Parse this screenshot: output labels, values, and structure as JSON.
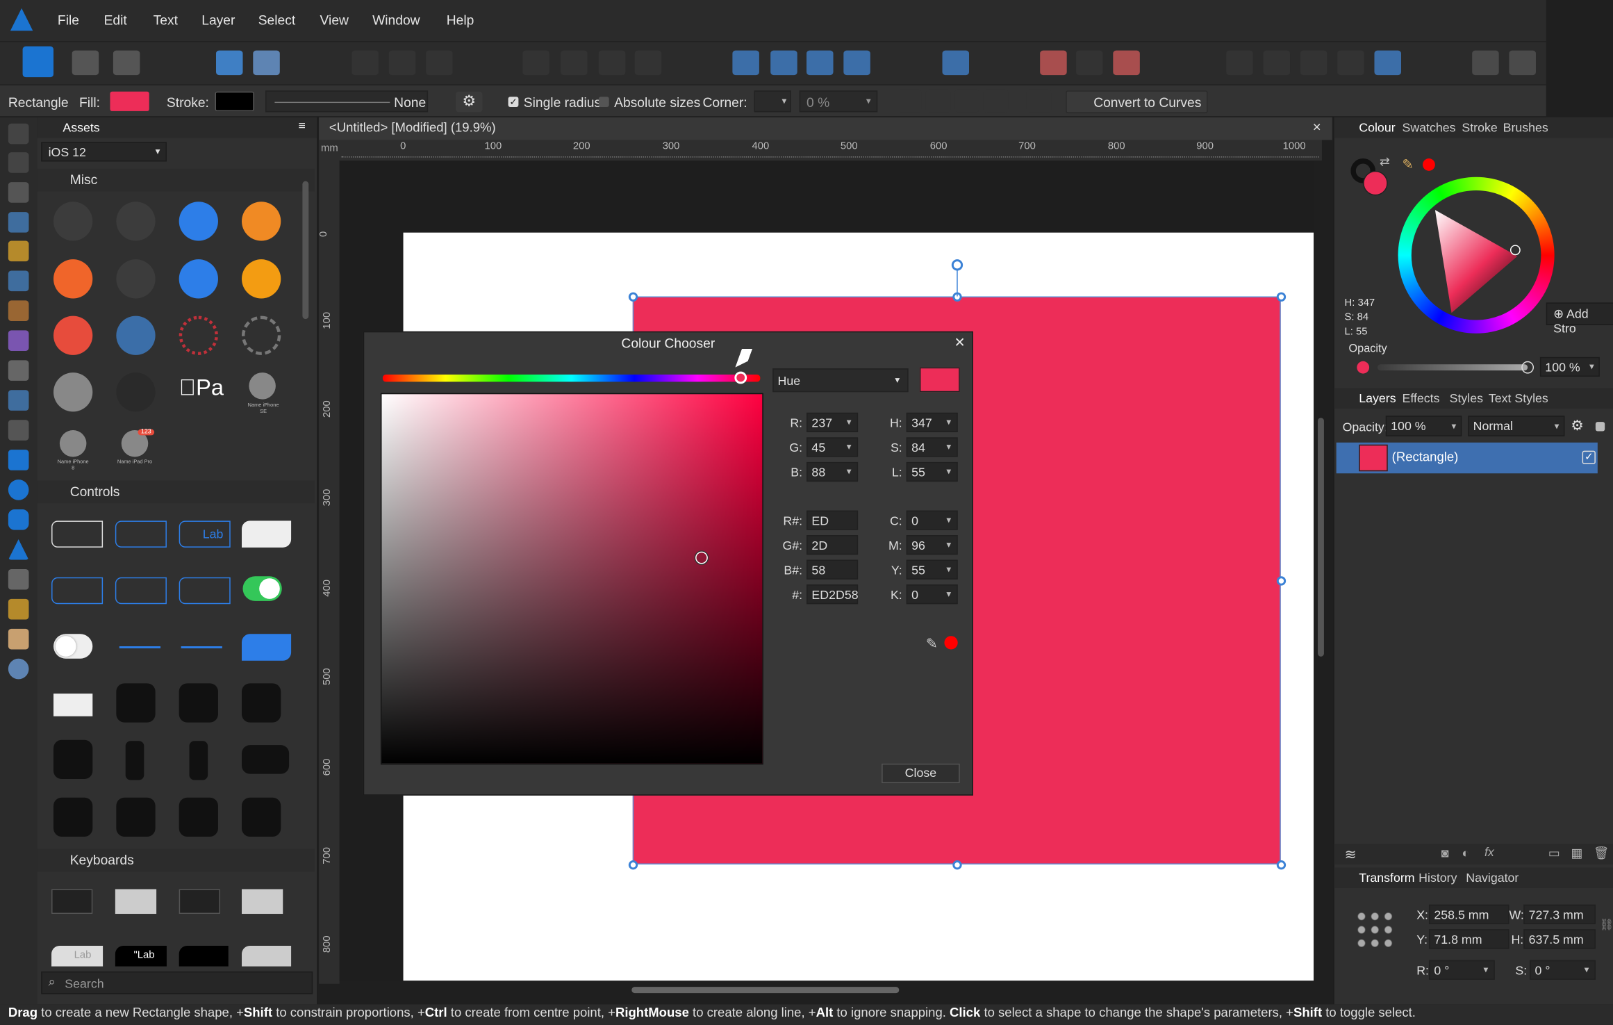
{
  "menu": [
    "File",
    "Edit",
    "Text",
    "Layer",
    "Select",
    "View",
    "Window",
    "Help"
  ],
  "context": {
    "tool_name": "Rectangle",
    "fill_label": "Fill:",
    "stroke_label": "Stroke:",
    "stroke_none": "None",
    "single_radius": "Single radius",
    "absolute_sizes": "Absolute sizes",
    "corner_label": "Corner:",
    "corner_pct": "0 %",
    "convert": "Convert to Curves"
  },
  "assets": {
    "tab": "Assets",
    "set": "iOS 12",
    "sections": [
      "Misc",
      "Controls",
      "Keyboards"
    ],
    "search_placeholder": "Search",
    "misc_labels": [
      "Name iPhone SE",
      "Name iPhone 8",
      "Name iPad Pro"
    ],
    "badge": "123",
    "apple_pay": "Pa",
    "label_text": "Lab",
    "kb_label": "\"Lab"
  },
  "document": {
    "title": "<Untitled> [Modified] (19.9%)",
    "unit": "mm",
    "ruler_h": [
      "0",
      "100",
      "200",
      "300",
      "400",
      "500",
      "600",
      "700",
      "800",
      "900",
      "1000"
    ],
    "ruler_v": [
      "0",
      "100",
      "200",
      "300",
      "400",
      "500",
      "600",
      "700",
      "800"
    ]
  },
  "dialog": {
    "title": "Colour Chooser",
    "mode": "Hue",
    "r": "237",
    "g": "45",
    "b": "88",
    "h": "347",
    "s": "84",
    "l": "55",
    "rhex": "ED",
    "ghex": "2D",
    "bhex": "58",
    "hex": "ED2D58",
    "c": "0",
    "m": "96",
    "y": "55",
    "k": "0",
    "close": "Close",
    "labels": {
      "r": "R:",
      "g": "G:",
      "b": "B:",
      "h": "H:",
      "s": "S:",
      "l": "L:",
      "rh": "R#:",
      "gh": "G#:",
      "bh": "B#:",
      "hx": "#:",
      "c": "C:",
      "m": "M:",
      "y": "Y:",
      "k": "K:"
    }
  },
  "colour_panel": {
    "tabs": [
      "Colour",
      "Swatches",
      "Stroke",
      "Brushes"
    ],
    "h": "H: 347",
    "s": "S: 84",
    "l": "L: 55",
    "opacity_label": "Opacity",
    "opacity": "100 %",
    "add_stroke": "Add Stro"
  },
  "layers_panel": {
    "tabs": [
      "Layers",
      "Effects",
      "Styles",
      "Text Styles"
    ],
    "opacity_label": "Opacity:",
    "opacity": "100 %",
    "blend": "Normal",
    "layer_name": "(Rectangle)"
  },
  "transform_panel": {
    "tabs": [
      "Transform",
      "History",
      "Navigator"
    ],
    "x_label": "X:",
    "x": "258.5 mm",
    "y_label": "Y:",
    "y": "71.8 mm",
    "w_label": "W:",
    "w": "727.3 mm",
    "h_label": "H:",
    "h": "637.5 mm",
    "r_label": "R:",
    "r": "0 °",
    "s_label": "S:",
    "s": "0 °"
  },
  "status": {
    "parts": [
      {
        "b": "Drag",
        "t": " to create a new Rectangle shape, +"
      },
      {
        "b": "Shift",
        "t": " to constrain proportions, +"
      },
      {
        "b": "Ctrl",
        "t": " to create from centre point, +"
      },
      {
        "b": "RightMouse",
        "t": " to create along line, +"
      },
      {
        "b": "Alt",
        "t": " to ignore snapping. "
      },
      {
        "b": "Click",
        "t": " to select a shape to change the shape's parameters, +"
      },
      {
        "b": "Shift",
        "t": " to toggle select."
      }
    ]
  },
  "colors": {
    "fill": "#ED2D58",
    "accent": "#3b82d6",
    "stroke": "#000000"
  }
}
